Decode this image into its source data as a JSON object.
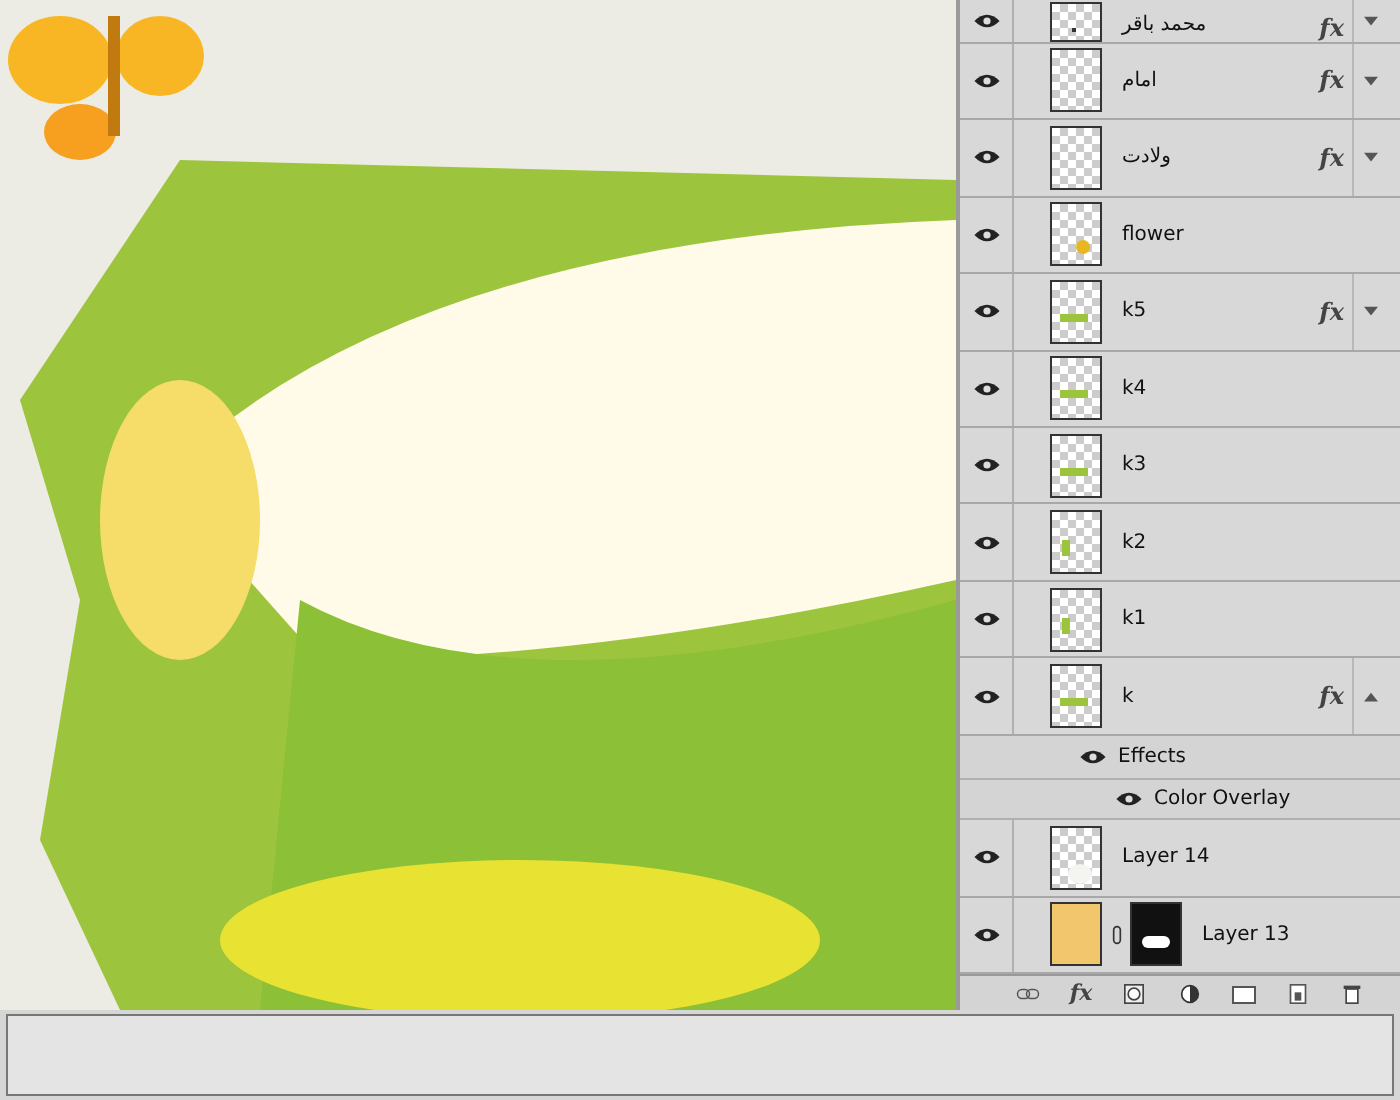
{
  "layers_panel": {
    "layers": [
      {
        "name": "محمد باقر",
        "visible": true,
        "kind": "dot",
        "fx": "fx",
        "expanded": false
      },
      {
        "name": "امام",
        "visible": true,
        "kind": "empty",
        "fx": "fx",
        "expanded": false
      },
      {
        "name": "ولادت",
        "visible": true,
        "kind": "empty",
        "fx": "fx",
        "expanded": false
      },
      {
        "name": "flower",
        "visible": true,
        "kind": "flower"
      },
      {
        "name": "k5",
        "visible": true,
        "kind": "stroke",
        "fx": "fx",
        "expanded": false
      },
      {
        "name": "k4",
        "visible": true,
        "kind": "stroke"
      },
      {
        "name": "k3",
        "visible": true,
        "kind": "stroke"
      },
      {
        "name": "k2",
        "visible": true,
        "kind": "bar"
      },
      {
        "name": "k1",
        "visible": true,
        "kind": "bar"
      },
      {
        "name": "k",
        "visible": true,
        "kind": "stroke",
        "fx": "fx",
        "expanded": true,
        "effects_label": "Effects",
        "effects": [
          {
            "name": "Color Overlay",
            "visible": true
          }
        ]
      },
      {
        "name": "Layer 14",
        "visible": true,
        "kind": "glow"
      },
      {
        "name": "Layer 13",
        "visible": true,
        "kind": "texture",
        "mask": true
      }
    ],
    "toolbar_fx": "fx"
  }
}
